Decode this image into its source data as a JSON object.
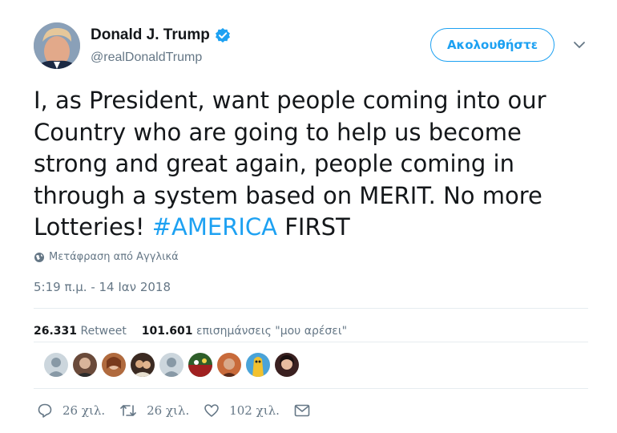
{
  "header": {
    "display_name": "Donald J. Trump",
    "handle": "@realDonaldTrump",
    "follow_label": "Ακολουθήστε",
    "verified_icon": "verified-badge-icon",
    "caret_icon": "chevron-down-icon"
  },
  "tweet": {
    "text_main": "I, as President, want people coming into our Country who are going to help us become strong and great again, people coming in through a system based on MERIT. No more Lotteries! ",
    "hashtag": "#AMERICA",
    "text_tail": " FIRST",
    "translate_label": "Μετάφραση από Αγγλικά",
    "timestamp": "5:19 π.μ. - 14 Ιαν 2018"
  },
  "stats": {
    "retweets_count": "26.331",
    "retweets_label": "Retweet",
    "likes_count": "101.601",
    "likes_label": "επισημάνσεις \"μου αρέσει\""
  },
  "liker_avatars": [
    "avatar-1",
    "avatar-2",
    "avatar-3",
    "avatar-4",
    "avatar-5",
    "avatar-6",
    "avatar-7",
    "avatar-8",
    "avatar-9",
    "avatar-10"
  ],
  "actions": {
    "reply_count": "26 χιλ.",
    "retweet_count": "26 χιλ.",
    "like_count": "102 χιλ."
  },
  "colors": {
    "accent": "#1da1f2",
    "text": "#14171a",
    "secondary": "#657786",
    "divider": "#e6ecf0"
  }
}
